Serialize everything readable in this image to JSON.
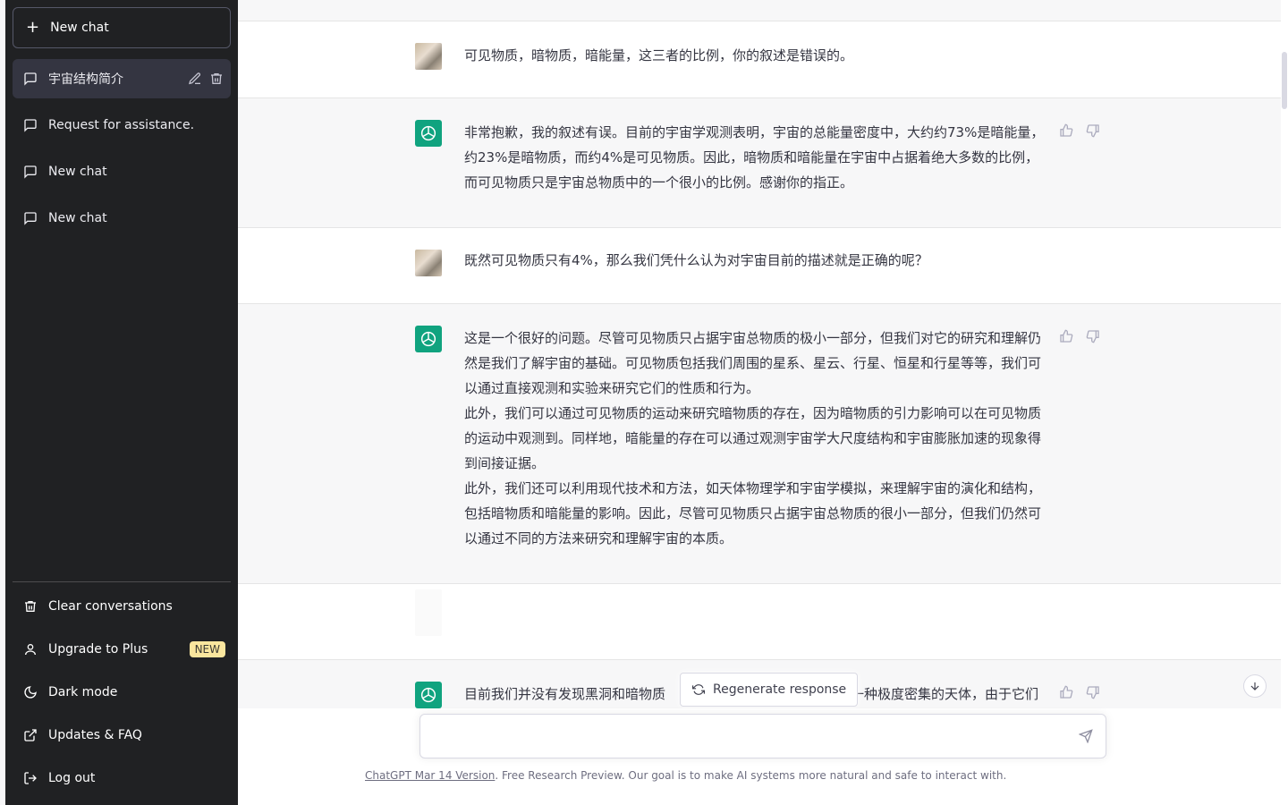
{
  "sidebar": {
    "new_chat_label": "New chat",
    "conversations": [
      {
        "label": "宇宙结构简介",
        "active": true
      },
      {
        "label": "Request for assistance."
      },
      {
        "label": "New chat"
      },
      {
        "label": "New chat"
      }
    ],
    "menu": {
      "clear": "Clear conversations",
      "upgrade": "Upgrade to Plus",
      "upgrade_badge": "NEW",
      "dark_mode": "Dark mode",
      "updates": "Updates & FAQ",
      "logout": "Log out"
    }
  },
  "messages": [
    {
      "role": "user",
      "text": "可见物质，暗物质，暗能量，这三者的比例，你的叙述是错误的。"
    },
    {
      "role": "assistant",
      "paragraphs": [
        "非常抱歉，我的叙述有误。目前的宇宙学观测表明，宇宙的总能量密度中，大约约73%是暗能量，约23%是暗物质，而约4%是可见物质。因此，暗物质和暗能量在宇宙中占据着绝大多数的比例，而可见物质只是宇宙总物质中的一个很小的比例。感谢你的指正。"
      ]
    },
    {
      "role": "user",
      "text": "既然可见物质只有4%，那么我们凭什么认为对宇宙目前的描述就是正确的呢？"
    },
    {
      "role": "assistant",
      "paragraphs": [
        "这是一个很好的问题。尽管可见物质只占据宇宙总物质的极小一部分，但我们对它的研究和理解仍然是我们了解宇宙的基础。可见物质包括我们周围的星系、星云、行星、恒星和行星等等，我们可以通过直接观测和实验来研究它们的性质和行为。",
        "此外，我们可以通过可见物质的运动来研究暗物质的存在，因为暗物质的引力影响可以在可见物质的运动中观测到。同样地，暗能量的存在可以通过观测宇宙学大尺度结构和宇宙膨胀加速的现象得到间接证据。",
        "此外，我们还可以利用现代技术和方法，如天体物理学和宇宙学模拟，来理解宇宙的演化和结构，包括暗物质和暗能量的影响。因此，尽管可见物质只占据宇宙总物质的很小一部分，但我们仍然可以通过不同的方法来研究和理解宇宙的本质。"
      ]
    },
    {
      "role": "user",
      "text": ""
    },
    {
      "role": "assistant",
      "text_left": "目前我们并没有发现黑洞和暗物质",
      "text_right": "一种极度密集的天体，由于它们"
    }
  ],
  "composer": {
    "regenerate_label": "Regenerate response",
    "placeholder": ""
  },
  "footer": {
    "version_link": "ChatGPT Mar 14 Version",
    "note": ". Free Research Preview. Our goal is to make AI systems more natural and safe to interact with."
  },
  "colors": {
    "sidebar_bg": "#202123",
    "assistant_accent": "#10a37f",
    "badge_bg": "#fae69e"
  }
}
